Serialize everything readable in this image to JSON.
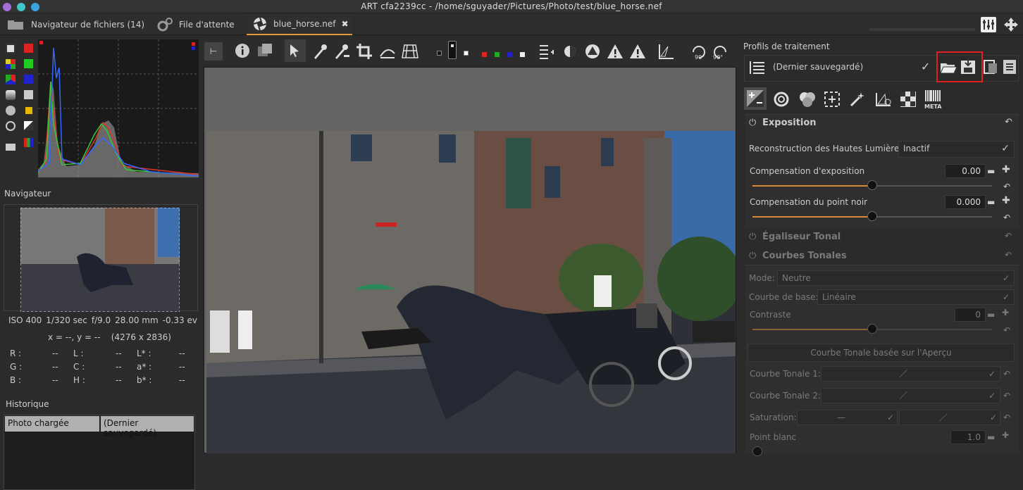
{
  "window": {
    "title": "ART cfa2239cc - /home/sguyader/Pictures/Photo/test/blue_horse.nef"
  },
  "tabs": {
    "browser": "Navigateur de fichiers  (14)",
    "queue": "File d'attente",
    "editor": "blue_horse.nef"
  },
  "navigator": {
    "title": "Navigateur",
    "iso": "ISO 400",
    "shutter": "1/320 sec",
    "aperture": "f/9.0",
    "focal": "28.00 mm",
    "ev": "-0.33 ev",
    "coords": "x = --, y = --",
    "dims": "(4276 x 2836)",
    "r": "R :",
    "g": "G :",
    "b": "B :",
    "l": "L :",
    "c": "C :",
    "h": "H :",
    "ls": "L* :",
    "as": "a* :",
    "bs": "b* :",
    "dash": "--"
  },
  "history": {
    "title": "Historique",
    "col1": "Photo chargée",
    "col2": "(Dernier sauvegardé)"
  },
  "profiles": {
    "title": "Profils de traitement",
    "selected": "(Dernier sauvegardé)"
  },
  "exposure": {
    "title": "Exposition",
    "hl_label": "Reconstruction des Hautes Lumières:",
    "hl_value": "Inactif",
    "comp_label": "Compensation d'exposition",
    "comp_value": "0.00",
    "comp_level": 0.5,
    "black_label": "Compensation du point noir",
    "black_value": "0.000",
    "black_level": 0.5
  },
  "tonal_eq": {
    "title": "Égaliseur Tonal"
  },
  "curves": {
    "title": "Courbes Tonales",
    "mode_label": "Mode:",
    "mode_value": "Neutre",
    "base_label": "Courbe de base:",
    "base_value": "Linéaire",
    "contrast_label": "Contraste",
    "contrast_value": "0",
    "contrast_level": 0.5,
    "auto_button": "Courbe Tonale basée sur l'Aperçu",
    "c1_label": "Courbe Tonale 1:",
    "c2_label": "Courbe Tonale 2:",
    "sat_label": "Saturation:",
    "white_label": "Point blanc",
    "white_value": "1.0"
  },
  "meta_tab": "META",
  "colors": {
    "accent": "#d8883a",
    "highlight_box": "#e02020"
  }
}
